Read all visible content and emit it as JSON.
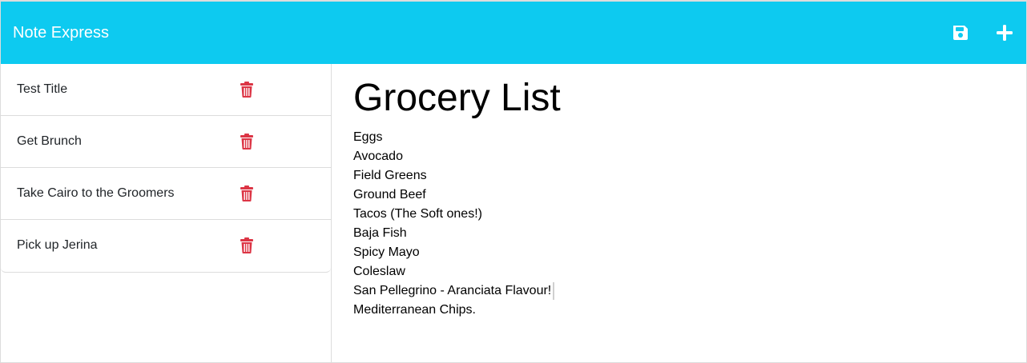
{
  "app": {
    "title": "Note Express",
    "colors": {
      "navbar": "#0dcaf0",
      "icon_white": "#ffffff",
      "delete_red": "#dc3545"
    }
  },
  "toolbar": {
    "save_icon": "save-icon",
    "add_icon": "plus-icon"
  },
  "sidebar": {
    "notes": [
      {
        "title": "Test Title",
        "delete_icon": "trash-icon"
      },
      {
        "title": "Get Brunch",
        "delete_icon": "trash-icon"
      },
      {
        "title": "Take Cairo to the Groomers",
        "delete_icon": "trash-icon"
      },
      {
        "title": "Pick up Jerina",
        "delete_icon": "trash-icon"
      }
    ]
  },
  "editor": {
    "title": "Grocery List",
    "lines": [
      "Eggs",
      "Avocado",
      "Field Greens",
      "Ground Beef",
      "Tacos (The Soft ones!)",
      "Baja Fish",
      "Spicy Mayo",
      "Coleslaw",
      "San Pellegrino - Aranciata Flavour!",
      "Mediterranean Chips."
    ]
  }
}
